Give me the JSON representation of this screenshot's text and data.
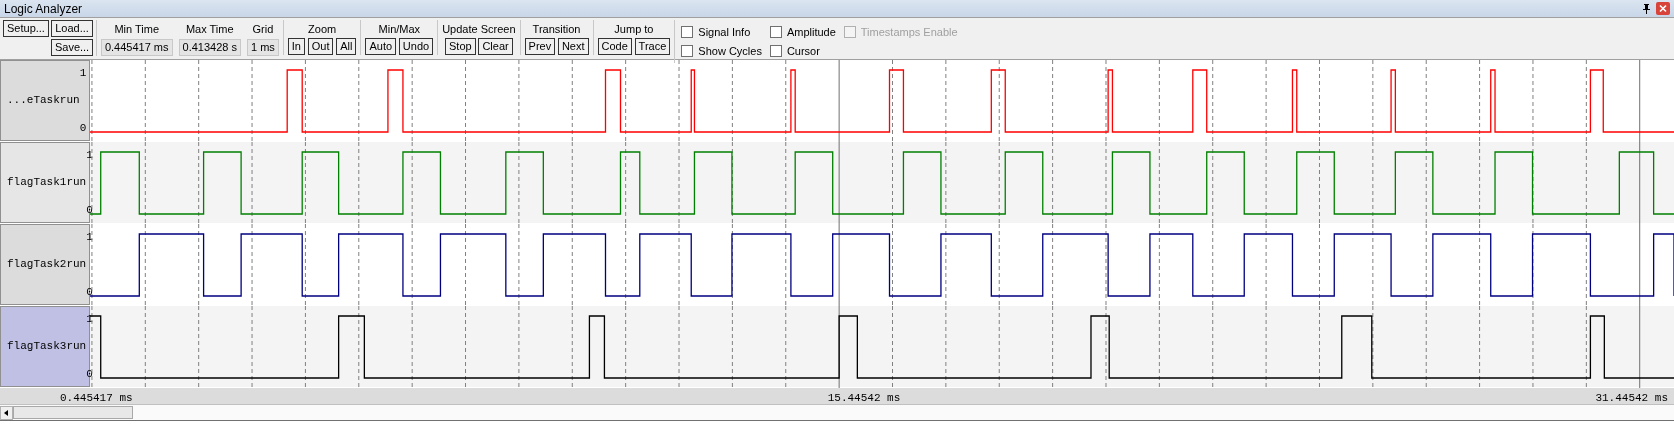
{
  "window": {
    "title": "Logic Analyzer"
  },
  "toolbar": {
    "file_buttons": [
      "Setup...",
      "Load...",
      "Save..."
    ],
    "fields": [
      {
        "label": "Min Time",
        "value": "0.445417 ms"
      },
      {
        "label": "Max Time",
        "value": "0.413428 s"
      },
      {
        "label": "Grid",
        "value": "1 ms"
      }
    ],
    "groups": [
      {
        "label": "Zoom",
        "buttons": [
          "In",
          "Out",
          "All"
        ]
      },
      {
        "label": "Min/Max",
        "buttons": [
          "Auto",
          "Undo"
        ]
      },
      {
        "label": "Update Screen",
        "buttons": [
          "Stop",
          "Clear"
        ]
      },
      {
        "label": "Transition",
        "buttons": [
          "Prev",
          "Next"
        ]
      },
      {
        "label": "Jump to",
        "buttons": [
          "Code",
          "Trace"
        ]
      }
    ],
    "checkboxes": [
      {
        "label": "Signal Info",
        "checked": false,
        "disabled": false
      },
      {
        "label": "Amplitude",
        "checked": false,
        "disabled": false
      },
      {
        "label": "Timestamps Enable",
        "checked": false,
        "disabled": true
      },
      {
        "label": "Show Cycles",
        "checked": false,
        "disabled": false
      },
      {
        "label": "Cursor",
        "checked": false,
        "disabled": false
      }
    ]
  },
  "signals": [
    {
      "name": "...eTaskrun",
      "high": "1",
      "low": "0",
      "color": "#ff0000",
      "selected": false
    },
    {
      "name": "flagTask1run",
      "high": "1",
      "low": "0",
      "color": "#008000",
      "selected": false
    },
    {
      "name": "flagTask2run",
      "high": "1",
      "low": "0",
      "color": "#000080",
      "selected": false
    },
    {
      "name": "flagTask3run",
      "high": "1",
      "low": "0",
      "color": "#000000",
      "selected": true
    }
  ],
  "time_axis": [
    "0.445417 ms",
    "15.44542 ms",
    "31.44542 ms"
  ]
}
